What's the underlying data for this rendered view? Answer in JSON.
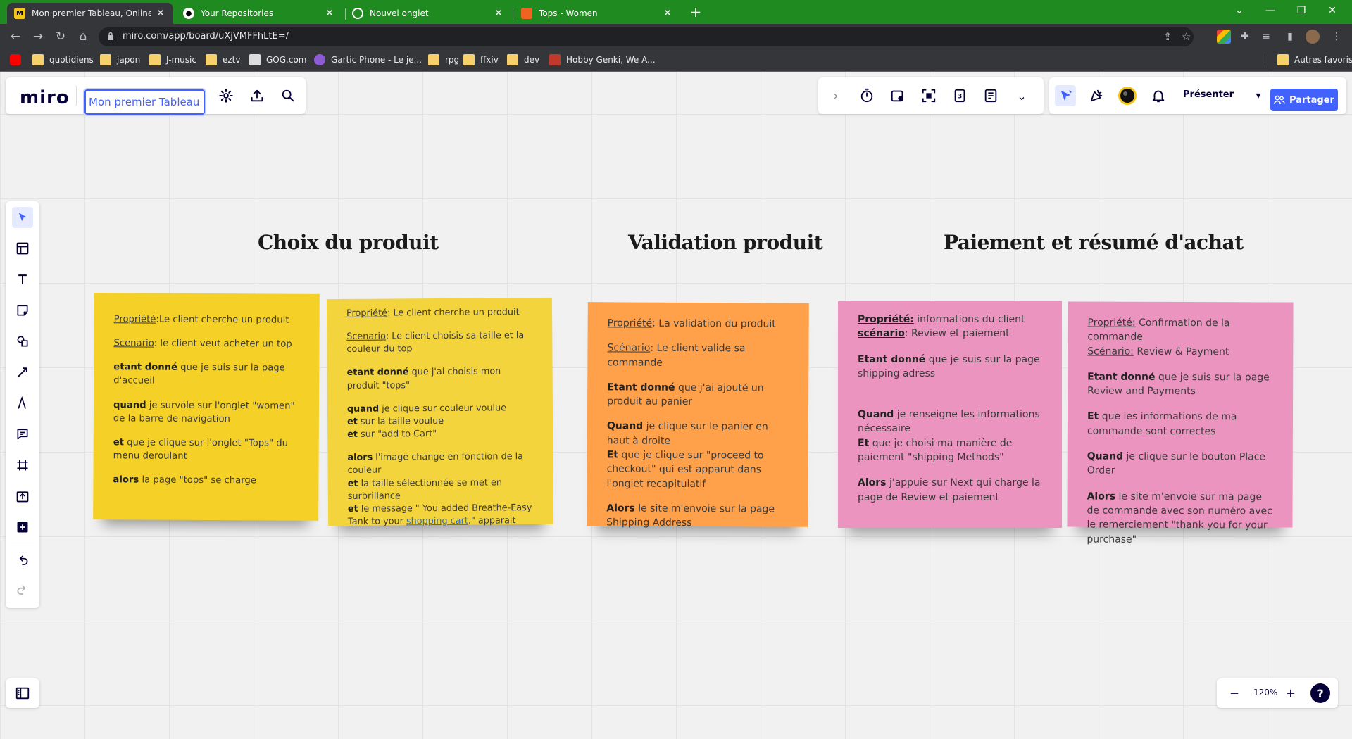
{
  "browser": {
    "tabs": [
      {
        "title": "Mon premier Tableau, Online Wh",
        "active": true
      },
      {
        "title": "Your Repositories",
        "active": false
      },
      {
        "title": "Nouvel onglet",
        "active": false
      },
      {
        "title": "Tops - Women",
        "active": false
      }
    ],
    "url": "miro.com/app/board/uXjVMFFhLtE=/",
    "bookmarks": [
      "quotidiens",
      "japon",
      "J-music",
      "eztv",
      "GOG.com",
      "Gartic Phone - Le je...",
      "rpg",
      "ffxiv",
      "dev",
      "Hobby Genki, We A..."
    ],
    "other_bookmarks": "Autres favoris"
  },
  "miro": {
    "logo": "miro",
    "board_name": "Mon premier Tableau",
    "present_label": "Présenter",
    "share_label": "Partager",
    "zoom": "120%",
    "help": "?",
    "accent": "#4262ff"
  },
  "headings": {
    "h1": "Choix du produit",
    "h2": "Validation produit",
    "h3": "Paiement et résumé d'achat"
  },
  "notes": {
    "n1": {
      "p1_u": "Propriété",
      "p1": ":Le client cherche un produit",
      "p2_u": "Scenario",
      "p2": ": le client veut acheter un top",
      "p3_b": "etant donné",
      "p3": " que je suis sur la page d'accueil",
      "p4_b": "quand",
      "p4": " je survole sur l'onglet \"women\" de la barre de navigation",
      "p5_b": "et",
      "p5": " que je clique sur l'onglet \"Tops\" du menu deroulant",
      "p6_b": "alors",
      "p6": " la page \"tops\" se charge"
    },
    "n2": {
      "p1_u": "Propriété",
      "p1": ": Le client cherche un produit",
      "p2_u": "Scenario",
      "p2": ": Le client choisis sa taille et la couleur du top",
      "p3_b": "etant donné",
      "p3": " que j'ai choisis mon produit \"tops\"",
      "p4_b": "quand",
      "p4": " je clique sur couleur voulue",
      "p4b_b": "et",
      "p4b": " sur la taille voulue",
      "p4c_b": "et",
      "p4c": " sur \"add to Cart\"",
      "p5_b": "alors",
      "p5": " l'image change en fonction de la couleur",
      "p5b_b": "et",
      "p5b": " la taille sélectionnée se met en surbrillance",
      "p5c_b": "et",
      "p5c": " le message \" You added Breathe-Easy Tank to your ",
      "p5c_link": "shopping cart",
      "p5c_end": ".\" apparait"
    },
    "n3": {
      "p1_u": "Propriété",
      "p1": ": La validation du produit",
      "p2_u": "Scénario",
      "p2": ": Le client valide sa commande",
      "p3_b": "Etant donné",
      "p3": " que j'ai ajouté un produit au panier",
      "p4_b": "Quand",
      "p4": " je clique sur le panier en haut à droite",
      "p4b_b": "Et",
      "p4b": " que je clique sur \"proceed to checkout\" qui est apparut dans l'onglet recapitulatif",
      "p5_b": "Alors",
      "p5": " le site m'envoie sur la page Shipping Address"
    },
    "n4": {
      "p1_u": "Propriété:",
      "p1": " informations du client",
      "p2_u": "scénario",
      "p2": ": Review et paiement",
      "p3_b": "Etant donné",
      "p3": " que je suis sur la page shipping adress",
      "p4_b": "Quand",
      "p4": " je renseigne les informations nécessaire",
      "p4b_b": "Et",
      "p4b": " que je choisi ma manière de  paiement \"shipping Methods\"",
      "p5_b": "Alors",
      "p5": " j'appuie sur Next qui charge la page de Review et paiement"
    },
    "n5": {
      "p1_u": "Propriété:",
      "p1": " Confirmation de la commande",
      "p2_u": "Scénario:",
      "p2": " Review & Payment",
      "p3_b": "Etant donné",
      "p3": " que je suis sur la page Review and Payments",
      "p4_b": "Et",
      "p4": " que les informations de ma commande sont correctes",
      "p5_b": "Quand",
      "p5": " je clique sur le bouton Place Order",
      "p6_b": "Alors",
      "p6": " le site m'envoie sur ma page de commande avec son numéro avec le remerciement \"thank you for your purchase\""
    }
  }
}
